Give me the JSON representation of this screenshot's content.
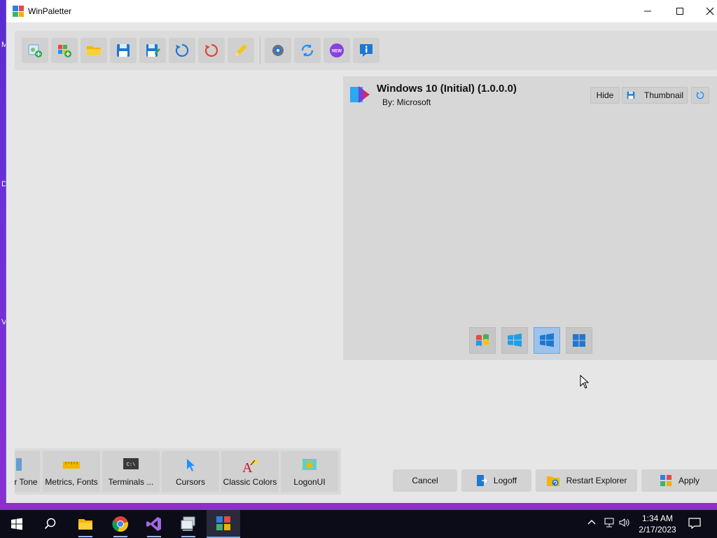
{
  "window": {
    "title": "WinPaletter",
    "controls": {
      "minimize": "—",
      "maximize": "☐",
      "close": "✕"
    }
  },
  "desktop": {
    "edge_letters": [
      "M",
      "D",
      "V"
    ]
  },
  "toolbar": {
    "buttons": [
      {
        "icon": "new-theme-icon"
      },
      {
        "icon": "new-from-preset-icon"
      },
      {
        "icon": "open-folder-icon"
      },
      {
        "icon": "save-icon"
      },
      {
        "icon": "save-as-icon"
      },
      {
        "icon": "apply-undo-icon"
      },
      {
        "icon": "restore-icon"
      },
      {
        "icon": "edit-info-icon"
      },
      {
        "icon": "settings-icon"
      },
      {
        "icon": "sync-icon"
      },
      {
        "icon": "whats-new-icon"
      },
      {
        "icon": "about-icon"
      }
    ]
  },
  "preview": {
    "theme_name": "Windows 10 (Initial) (1.0.0.0)",
    "author": "By: Microsoft",
    "hide_label": "Hide",
    "thumbnail_label": "Thumbnail",
    "versions": [
      {
        "name": "Windows 7",
        "selected": false
      },
      {
        "name": "Windows 8.1",
        "selected": false
      },
      {
        "name": "Windows 10",
        "selected": true
      },
      {
        "name": "Windows 11",
        "selected": false
      }
    ]
  },
  "tabs": [
    {
      "label": "r Tone"
    },
    {
      "label": "Metrics, Fonts"
    },
    {
      "label": "Terminals ..."
    },
    {
      "label": "Cursors"
    },
    {
      "label": "Classic Colors"
    },
    {
      "label": "LogonUI"
    }
  ],
  "actions": {
    "cancel": "Cancel",
    "logoff": "Logoff",
    "restart_explorer": "Restart Explorer",
    "apply": "Apply"
  },
  "taskbar": {
    "clock_time": "1:34 AM",
    "clock_date": "2/17/2023",
    "apps": [
      "start",
      "search",
      "file-explorer",
      "chrome",
      "visual-studio",
      "app-window",
      "winpaletter"
    ]
  },
  "colors": {
    "accent_blue": "#1e78d2",
    "selected_version": "#9cc3ec",
    "desktop_purple": "#6b2fd8"
  }
}
